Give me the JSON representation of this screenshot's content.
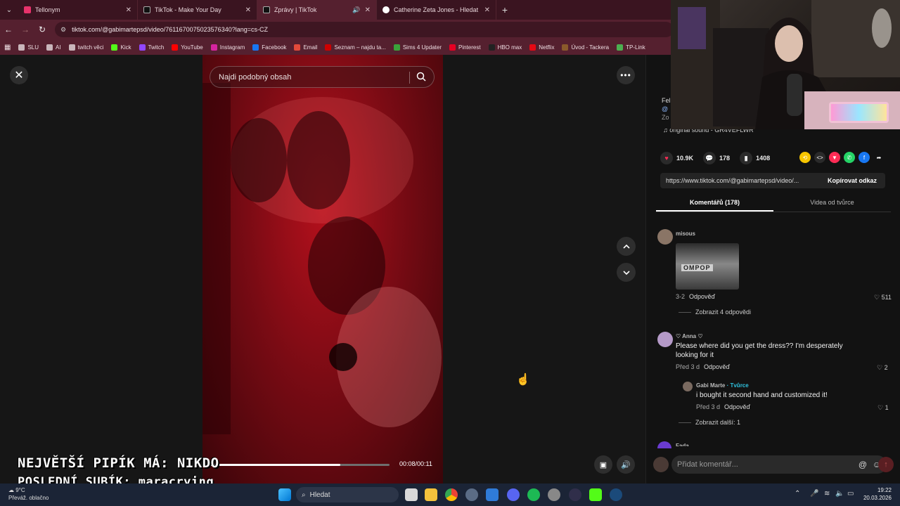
{
  "browser": {
    "tabs": [
      {
        "title": "Tellonym",
        "color": "#e8336b",
        "active": false
      },
      {
        "title": "TikTok - Make Your Day",
        "color": "#111111",
        "active": false
      },
      {
        "title": "Zprávy | TikTok",
        "color": "#111111",
        "active": true
      },
      {
        "title": "Catherine Zeta Jones - Hledat G",
        "color": "#4285f4",
        "active": false
      }
    ],
    "url": "tiktok.com/@gabimartepsd/video/7611670075023576340?lang=cs-CZ",
    "bookmarks": [
      {
        "label": "SLU",
        "color": "#c9b6bb"
      },
      {
        "label": "AI",
        "color": "#c9b6bb"
      },
      {
        "label": "twitch věci",
        "color": "#c9b6bb"
      },
      {
        "label": "Kick",
        "color": "#53fc18"
      },
      {
        "label": "Twitch",
        "color": "#9146ff"
      },
      {
        "label": "YouTube",
        "color": "#ff0000"
      },
      {
        "label": "Instagram",
        "color": "#d6249f"
      },
      {
        "label": "Facebook",
        "color": "#1877f2"
      },
      {
        "label": "Email",
        "color": "#e24a3b"
      },
      {
        "label": "Seznam – najdu ta...",
        "color": "#cc0000"
      },
      {
        "label": "Sims 4 Updater",
        "color": "#3aa23a"
      },
      {
        "label": "Pinterest",
        "color": "#e60023"
      },
      {
        "label": "HBO max",
        "color": "#222222"
      },
      {
        "label": "Netflix",
        "color": "#e50914"
      },
      {
        "label": "Úvod - Tackera",
        "color": "#8a5a2b"
      },
      {
        "label": "TP-Link",
        "color": "#4caf50"
      }
    ]
  },
  "video": {
    "search_placeholder": "Najdi podobný obsah",
    "progress": 0.727,
    "time": "00:08/00:11"
  },
  "overlay": {
    "line1": "NEJVĚTŠÍ PIPÍK MÁ: NIKDO",
    "line2": "POSLEDNÍ SUBÍK: maracrying"
  },
  "panel": {
    "author_fragment_1": "Fel",
    "author_fragment_2": "@",
    "author_fragment_3": "Zo",
    "sound": "original sound - GR4VEFLWR",
    "likes": "10.9K",
    "comments_count": "178",
    "saves": "1408",
    "link": "https://www.tiktok.com/@gabimartepsd/video/...",
    "copy_label": "Kopírovat odkaz",
    "tab_comments": "Komentářů (178)",
    "tab_creator": "Videa od tvůrce",
    "comments": [
      {
        "user": "misous",
        "meta": "3-2",
        "reply": "Odpověď",
        "likes": "511",
        "more": "Zobrazit 4 odpovědi",
        "sticker": "OMPOP"
      },
      {
        "user": "♡ Anna ♡",
        "text": "Please where did you get the dress?? I'm desperately looking for it",
        "meta": "Před 3 d",
        "reply": "Odpověď",
        "likes": "2"
      },
      {
        "user": "Gabi Marte",
        "creator_tag": "· Tvůrce",
        "text": "i bought it second hand and customized it!",
        "meta": "Před 3 d",
        "reply": "Odpověď",
        "likes": "1",
        "more": "Zobrazit další: 1"
      },
      {
        "user": "Fada"
      }
    ],
    "add_comment_placeholder": "Přidat komentář..."
  },
  "taskbar": {
    "temp": "9°C",
    "weather": "Převáž. oblačno",
    "search": "Hledat",
    "time": "19:22",
    "date": "20.03.2026"
  }
}
